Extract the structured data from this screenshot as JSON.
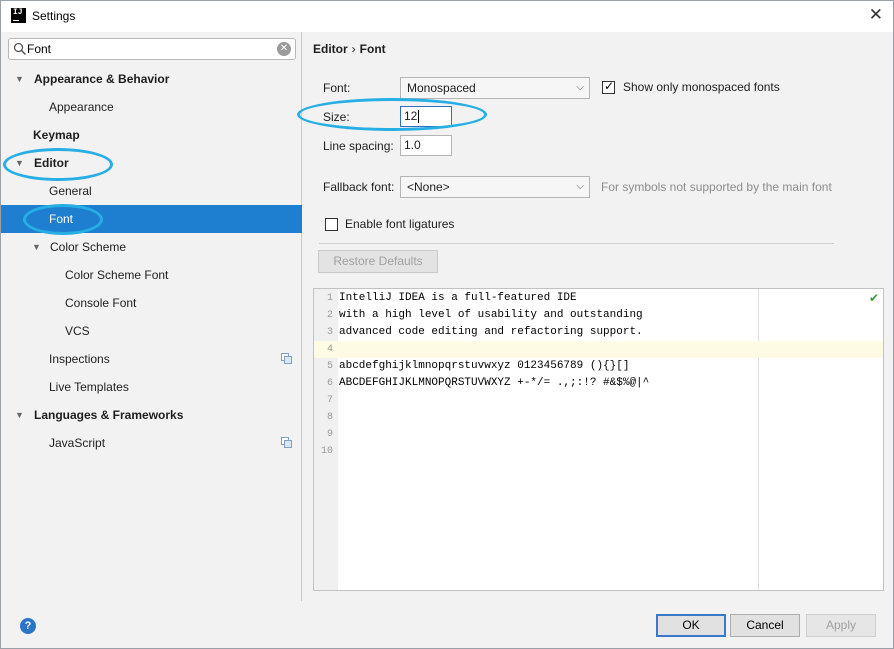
{
  "window": {
    "title": "Settings",
    "app_icon": "IJ"
  },
  "search": {
    "value": "Font"
  },
  "tree": {
    "appearance_behavior": "Appearance & Behavior",
    "appearance": "Appearance",
    "keymap": "Keymap",
    "editor": "Editor",
    "general": "General",
    "font": "Font",
    "color_scheme": "Color Scheme",
    "color_scheme_font": "Color Scheme Font",
    "console_font": "Console Font",
    "vcs": "VCS",
    "inspections": "Inspections",
    "live_templates": "Live Templates",
    "languages_frameworks": "Languages & Frameworks",
    "javascript": "JavaScript"
  },
  "breadcrumb": {
    "parent": "Editor",
    "separator": "›",
    "current": "Font"
  },
  "form": {
    "font_label": "Font:",
    "font_value": "Monospaced",
    "show_only_mono_label": "Show only monospaced fonts",
    "show_only_mono_checked": true,
    "size_label": "Size:",
    "size_value": "12",
    "line_spacing_label": "Line spacing:",
    "line_spacing_value": "1.0",
    "fallback_label": "Fallback font:",
    "fallback_value": "<None>",
    "fallback_hint": "For symbols not supported by the main font",
    "ligatures_label": "Enable font ligatures",
    "ligatures_checked": false,
    "restore_defaults": "Restore Defaults"
  },
  "preview": {
    "lines": [
      {
        "num": "1",
        "text": "IntelliJ IDEA is a full-featured IDE"
      },
      {
        "num": "2",
        "text": "with a high level of usability and outstanding"
      },
      {
        "num": "3",
        "text": "advanced code editing and refactoring support."
      },
      {
        "num": "4",
        "text": ""
      },
      {
        "num": "5",
        "text": "abcdefghijklmnopqrstuvwxyz 0123456789 (){}[]"
      },
      {
        "num": "6",
        "text": "ABCDEFGHIJKLMNOPQRSTUVWXYZ +-*/= .,;:!? #&$%@|^"
      },
      {
        "num": "7",
        "text": ""
      },
      {
        "num": "8",
        "text": ""
      },
      {
        "num": "9",
        "text": ""
      },
      {
        "num": "10",
        "text": ""
      }
    ],
    "current_line": "4"
  },
  "buttons": {
    "ok": "OK",
    "cancel": "Cancel",
    "apply": "Apply",
    "help": "?"
  },
  "colors": {
    "selection": "#1e7ed0",
    "annotation": "#27aee4",
    "current_line": "#fefbe4"
  }
}
